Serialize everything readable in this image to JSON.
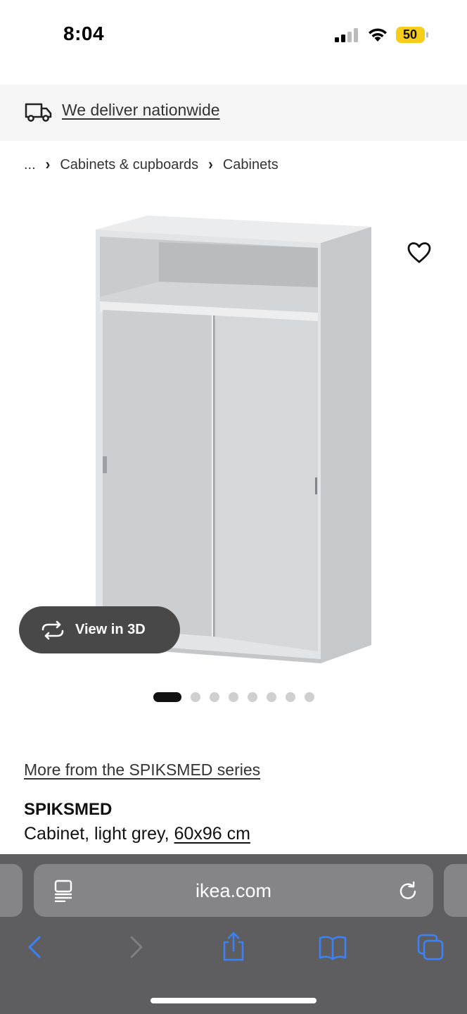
{
  "status_bar": {
    "time": "8:04",
    "battery_level": "50",
    "battery_color": "#f7cc1a"
  },
  "banner": {
    "icon": "delivery-truck-icon",
    "text": "We deliver nationwide"
  },
  "breadcrumb": {
    "items": [
      "...",
      "Cabinets & cupboards",
      "Cabinets"
    ],
    "separator": "›"
  },
  "product_image": {
    "favorite_icon": "heart-icon",
    "view_3d_label": "View in 3D",
    "carousel": {
      "count": 8,
      "active_index": 0
    }
  },
  "product": {
    "series_link": "More from the SPIKSMED series",
    "name": "SPIKSMED",
    "description": "Cabinet, light grey,",
    "size": "60x96 cm"
  },
  "browser": {
    "url": "ikea.com",
    "icons": [
      "reader-mode-icon",
      "reload-icon",
      "back-icon",
      "forward-icon",
      "share-icon",
      "bookmarks-icon",
      "tabs-icon"
    ],
    "accent_color": "#3b82f6"
  }
}
